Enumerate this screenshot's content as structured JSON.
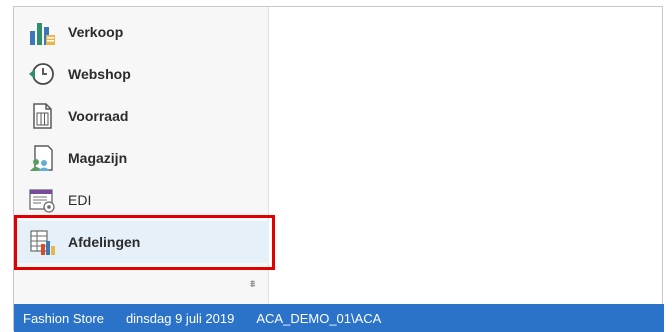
{
  "sidebar": {
    "items": [
      {
        "label": "Verkoop",
        "icon": "sales-chart-icon"
      },
      {
        "label": "Webshop",
        "icon": "webshop-clock-icon"
      },
      {
        "label": "Voorraad",
        "icon": "inventory-document-icon"
      },
      {
        "label": "Magazijn",
        "icon": "warehouse-people-icon"
      },
      {
        "label": "EDI",
        "icon": "edi-form-icon"
      },
      {
        "label": "Afdelingen",
        "icon": "departments-grid-icon",
        "selected": true
      }
    ],
    "overflow_glyph": "⩩"
  },
  "statusbar": {
    "store": "Fashion Store",
    "date": "dinsdag 9 juli 2019",
    "user": "ACA_DEMO_01\\ACA"
  },
  "colors": {
    "statusbar_bg": "#2b73c8",
    "highlight_border": "#e10000",
    "selected_bg": "#e6f0f8"
  }
}
